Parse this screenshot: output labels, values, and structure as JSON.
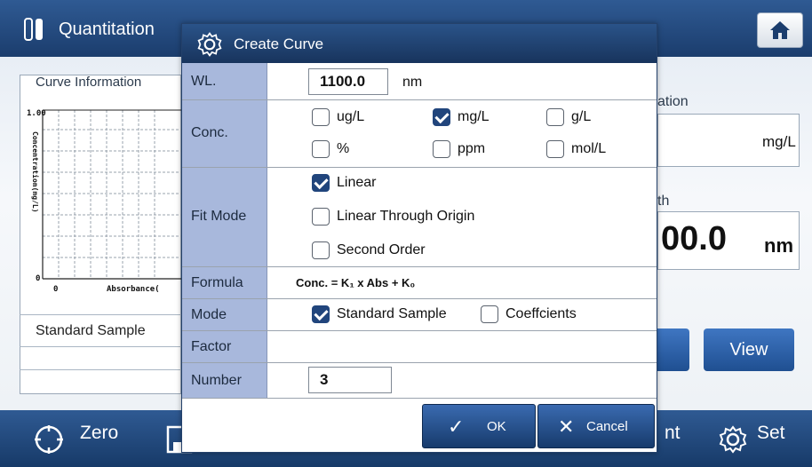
{
  "app": {
    "title": "Quantitation",
    "left_panel": {
      "heading": "Curve Information",
      "chart_y_max": "1.00",
      "chart_y_label": "Concentration(mg/L)",
      "chart_x_min": "0",
      "chart_y_min": "0",
      "chart_x_label": "Absorbance(",
      "mode_value": "Standard Sample"
    },
    "right_panel": {
      "frag_ation": "ation",
      "unit_value": "mg/L",
      "frag_th": "th",
      "wavelength_value": "00.0",
      "wavelength_unit": "nm",
      "view_button": "View"
    },
    "bottom_bar": {
      "zero": "Zero",
      "nt_fragment": "nt",
      "set": "Set"
    }
  },
  "dialog": {
    "title": "Create Curve",
    "wl": {
      "label": "WL.",
      "value": "1100.0",
      "unit": "nm"
    },
    "conc": {
      "label": "Conc.",
      "options": [
        {
          "label": "ug/L",
          "checked": false
        },
        {
          "label": "mg/L",
          "checked": true
        },
        {
          "label": "g/L",
          "checked": false
        },
        {
          "label": "%",
          "checked": false
        },
        {
          "label": "ppm",
          "checked": false
        },
        {
          "label": "mol/L",
          "checked": false
        }
      ]
    },
    "fit_mode": {
      "label": "Fit Mode",
      "options": [
        {
          "label": "Linear",
          "checked": true
        },
        {
          "label": "Linear Through Origin",
          "checked": false
        },
        {
          "label": "Second Order",
          "checked": false
        }
      ]
    },
    "formula": {
      "label": "Formula",
      "value": "Conc. = K₁ x Abs + K₀"
    },
    "mode": {
      "label": "Mode",
      "options": [
        {
          "label": "Standard Sample",
          "checked": true
        },
        {
          "label": "Coeffcients",
          "checked": false
        }
      ]
    },
    "factor": {
      "label": "Factor"
    },
    "number": {
      "label": "Number",
      "value": "3"
    },
    "ok_button": "OK",
    "cancel_button": "Cancel"
  },
  "colors": {
    "bar_blue": "#1b3d6d",
    "label_cell": "#a8b8dc",
    "checked": "#21457c"
  }
}
